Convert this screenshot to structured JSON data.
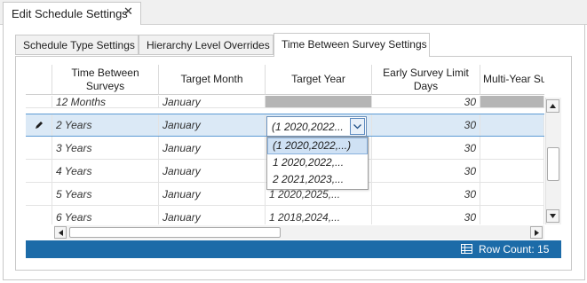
{
  "document_tab": {
    "title": "Edit Schedule Settings",
    "close_glyph": "✕"
  },
  "tabs": [
    {
      "label": "Schedule Type Settings",
      "active": false
    },
    {
      "label": "Hierarchy Level Overrides",
      "active": false
    },
    {
      "label": "Time Between Survey Settings",
      "active": true
    }
  ],
  "grid": {
    "columns": [
      {
        "key": "time",
        "label": "Time Between Surveys"
      },
      {
        "key": "month",
        "label": "Target Month"
      },
      {
        "key": "year",
        "label": "Target Year"
      },
      {
        "key": "early",
        "label": "Early Survey Limit Days"
      },
      {
        "key": "multi",
        "label": "Multi-Year Survey Start"
      }
    ],
    "rows": [
      {
        "time": "12 Months",
        "month": "January",
        "year": "",
        "early": "30",
        "multi": "",
        "grey": true
      },
      {
        "time": "2 Years",
        "month": "January",
        "year": "(1   2020,2022...",
        "early": "30",
        "multi": "",
        "selected": true,
        "editing": true
      },
      {
        "time": "3 Years",
        "month": "January",
        "year": "",
        "early": "30",
        "multi": ""
      },
      {
        "time": "4 Years",
        "month": "January",
        "year": "",
        "early": "30",
        "multi": ""
      },
      {
        "time": "5 Years",
        "month": "January",
        "year": "1   2020,2025,...",
        "early": "30",
        "multi": ""
      },
      {
        "time": "6 Years",
        "month": "January",
        "year": "1   2018,2024,...",
        "early": "30",
        "multi": ""
      }
    ],
    "dropdown_options": [
      "(1    2020,2022,...)",
      "1    2020,2022,...",
      "2    2021,2023,..."
    ],
    "highlighted_option": 0
  },
  "footer": {
    "row_count_label": "Row Count:",
    "row_count": "15"
  },
  "colors": {
    "accent": "#1c6ba8",
    "selection": "#dbe9f6",
    "selection_border": "#5d9bd4",
    "grey_cell": "#b5b5b5"
  },
  "icons": {
    "edit_row": "pencil-icon",
    "row_count": "grid-icon",
    "dropdown": "chevron-down-icon"
  }
}
